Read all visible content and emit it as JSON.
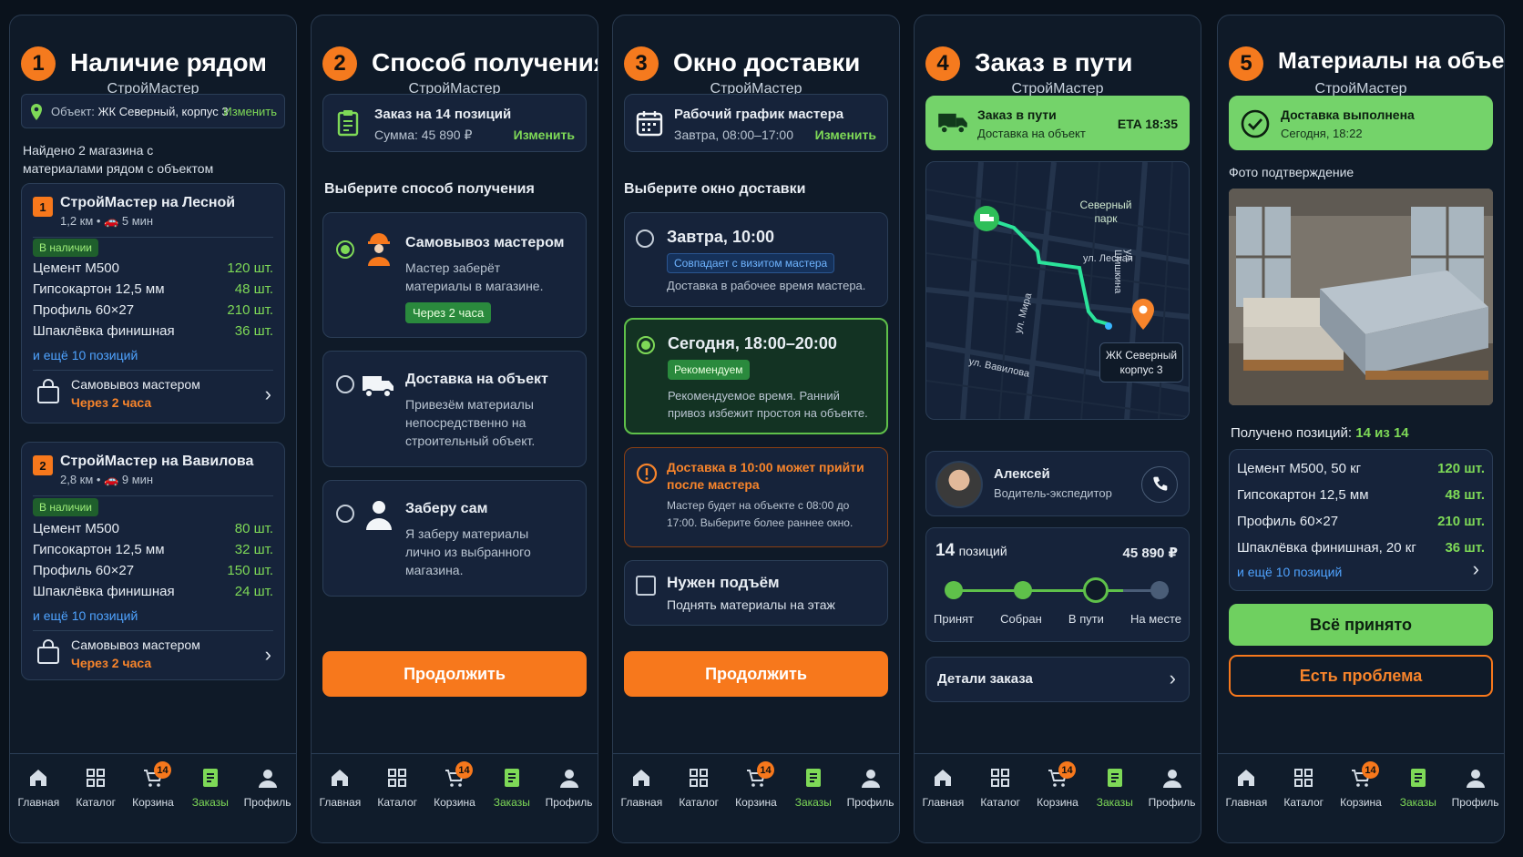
{
  "nav": [
    {
      "label": "Главная",
      "icon": "home-icon"
    },
    {
      "label": "Каталог",
      "icon": "grid-icon"
    },
    {
      "label": "Корзина",
      "icon": "cart-icon",
      "count": "14"
    },
    {
      "label": "Заказы",
      "icon": "orders-icon"
    },
    {
      "label": "Профиль",
      "icon": "profile-icon"
    }
  ],
  "s1": {
    "num": "1",
    "title": "Наличие рядом",
    "brand": "СтройМастер",
    "object_prefix": "Объект:",
    "object": "ЖК Северный, корпус 3",
    "change": "Изменить",
    "found": "Найдено 2 магазина с материалами рядом с объектом",
    "stores": [
      {
        "idx": "1",
        "name": "СтройМастер на Лесной",
        "meta": "1,2 км • 🚗 5 мин",
        "badge": "В наличии",
        "items": [
          [
            "Цемент М500",
            "120 шт."
          ],
          [
            "Гипсокартон 12,5 мм",
            "48 шт."
          ],
          [
            "Профиль 60×27",
            "210 шт."
          ],
          [
            "Шпаклёвка финишная",
            "36 шт."
          ]
        ],
        "more": "и ещё 10 позиций",
        "pickup": "Самовывоз мастером",
        "eta": "Через 2 часа"
      },
      {
        "idx": "2",
        "name": "СтройМастер на Вавилова",
        "meta": "2,8 км • 🚗 9 мин",
        "badge": "В наличии",
        "items": [
          [
            "Цемент М500",
            "80 шт."
          ],
          [
            "Гипсокартон 12,5 мм",
            "32 шт."
          ],
          [
            "Профиль 60×27",
            "150 шт."
          ],
          [
            "Шпаклёвка финишная",
            "24 шт."
          ]
        ],
        "more": "и ещё 10 позиций",
        "pickup": "Самовывоз мастером",
        "eta": "Через 2 часа"
      }
    ]
  },
  "s2": {
    "num": "2",
    "title": "Способ получения",
    "brand": "СтройМастер",
    "order": "Заказ на 14 позиций",
    "sum": "Сумма: 45 890 ₽",
    "change": "Изменить",
    "section": "Выберите способ получения",
    "options": [
      {
        "title": "Самовывоз мастером",
        "desc": "Мастер заберёт материалы в магазине.",
        "tag": "Через 2 часа",
        "selected": true
      },
      {
        "title": "Доставка на объект",
        "desc": "Привезём материалы непосредственно на строительный объект.",
        "selected": false
      },
      {
        "title": "Заберу сам",
        "desc": "Я заберу материалы лично из выбранного магазина.",
        "selected": false
      }
    ],
    "cta": "Продолжить"
  },
  "s3": {
    "num": "3",
    "title": "Окно доставки",
    "brand": "СтройМастер",
    "sched_title": "Рабочий график мастера",
    "sched": "Завтра, 08:00–17:00",
    "change": "Изменить",
    "section": "Выберите окно доставки",
    "opt1": {
      "title": "Завтра, 10:00",
      "tag": "Совпадает с визитом мастера",
      "desc": "Доставка в рабочее время мастера."
    },
    "opt2": {
      "title": "Сегодня, 18:00–20:00",
      "tag": "Рекомендуем",
      "desc": "Рекомендуемое время. Ранний привоз избежит простоя на объекте."
    },
    "warn": {
      "title": "Доставка в 10:00 может прийти после мастера",
      "desc": "Мастер будет на объекте с 08:00 до 17:00. Выберите более раннее окно."
    },
    "lift": {
      "title": "Нужен подъём",
      "desc": "Поднять материалы на этаж"
    },
    "cta": "Продолжить"
  },
  "s4": {
    "num": "4",
    "title": "Заказ в пути",
    "brand": "СтройМастер",
    "status": "Заказ в пути",
    "status_sub": "Доставка на объект",
    "eta": "ETA 18:35",
    "map": {
      "park": "Северный парк",
      "street1": "ул. Лесная",
      "street2": "ул. Вавилова",
      "street3": "ул. Мира",
      "street4": "ул. Шишкина",
      "dest": "ЖК Северный корпус 3"
    },
    "driver": {
      "name": "Алексей",
      "role": "Водитель-экспедитор"
    },
    "count": "14",
    "count_label": "позиций",
    "total": "45 890 ₽",
    "steps": [
      "Принят",
      "Собран",
      "В пути",
      "На месте"
    ],
    "details": "Детали заказа"
  },
  "s5": {
    "num": "5",
    "title": "Материалы на объекте",
    "brand": "СтройМастер",
    "done": "Доставка выполнена",
    "done_time": "Сегодня, 18:22",
    "photo": "Фото подтверждение",
    "received_label": "Получено позиций:",
    "received": "14 из 14",
    "items": [
      [
        "Цемент М500, 50 кг",
        "120 шт."
      ],
      [
        "Гипсокартон 12,5 мм",
        "48 шт."
      ],
      [
        "Профиль 60×27",
        "210 шт."
      ],
      [
        "Шпаклёвка финишная, 20 кг",
        "36 шт."
      ]
    ],
    "more": "и ещё 10 позиций",
    "ok": "Всё принято",
    "problem": "Есть проблема"
  }
}
